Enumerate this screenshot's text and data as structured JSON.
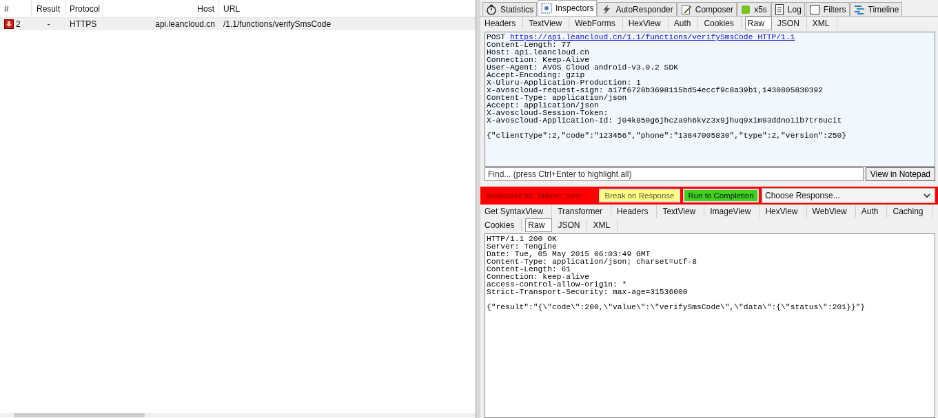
{
  "sessions": {
    "columns": [
      "#",
      "Result",
      "Protocol",
      "Host",
      "URL"
    ],
    "rows": [
      {
        "number": "2",
        "result": "-",
        "protocol": "HTTPS",
        "host": "api.leancloud.cn",
        "url": "/1.1/functions/verifySmsCode",
        "selected": false
      }
    ]
  },
  "main_tabs": [
    {
      "label": "Statistics",
      "selected": false
    },
    {
      "label": "Inspectors",
      "selected": true
    },
    {
      "label": "AutoResponder",
      "selected": false
    },
    {
      "label": "Composer",
      "selected": false
    },
    {
      "label": "x5s",
      "selected": false
    },
    {
      "label": "Log",
      "selected": false
    },
    {
      "label": "Filters",
      "selected": false
    },
    {
      "label": "Timeline",
      "selected": false
    }
  ],
  "request": {
    "tabs": [
      {
        "label": "Headers",
        "selected": false
      },
      {
        "label": "TextView",
        "selected": false
      },
      {
        "label": "WebForms",
        "selected": false
      },
      {
        "label": "HexView",
        "selected": false
      },
      {
        "label": "Auth",
        "selected": false
      },
      {
        "label": "Cookies",
        "selected": false
      },
      {
        "label": "Raw",
        "selected": true
      },
      {
        "label": "JSON",
        "selected": false
      },
      {
        "label": "XML",
        "selected": false
      }
    ],
    "method": "POST",
    "link": "https://api.leancloud.cn/1.1/functions/verifySmsCode HTTP/1.1",
    "lines": [
      "Content-Length: 77",
      "Host: api.leancloud.cn",
      "Connection: Keep-Alive",
      "User-Agent: AVOS Cloud android-v3.0.2 SDK",
      "Accept-Encoding: gzip",
      "X-Uluru-Application-Production: 1",
      "x-avoscloud-request-sign: a17f6728b3698115bd54eccf9c8a39b1,1430805830392",
      "Content-Type: application/json",
      "Accept: application/json",
      "X-avoscloud-Session-Token:",
      "X-avoscloud-Application-Id: j04k850g6jhcza9h6kvz3x9jhuq9xim93ddno1ib7tr6ucit"
    ],
    "body": "{\"clientType\":2,\"code\":\"123456\",\"phone\":\"13847005830\",\"type\":2,\"version\":250}",
    "find": {
      "placeholder": "Find... (press Ctrl+Enter to highlight all)"
    },
    "notepad_button": "View in Notepad"
  },
  "breakpoint": {
    "message": "Breakpoint hit. Tamper, then:",
    "break_button": "Break on Response",
    "run_button": "Run to Completion",
    "dropdown": "Choose Response..."
  },
  "response": {
    "tabs": [
      {
        "label": "Get SyntaxView",
        "selected": false
      },
      {
        "label": "Transformer",
        "selected": false
      },
      {
        "label": "Headers",
        "selected": false
      },
      {
        "label": "TextView",
        "selected": false
      },
      {
        "label": "ImageView",
        "selected": false
      },
      {
        "label": "HexView",
        "selected": false
      },
      {
        "label": "WebView",
        "selected": false
      },
      {
        "label": "Auth",
        "selected": false
      },
      {
        "label": "Caching",
        "selected": false
      }
    ],
    "tabs_row2": [
      {
        "label": "Cookies",
        "selected": false
      },
      {
        "label": "Raw",
        "selected": true
      },
      {
        "label": "JSON",
        "selected": false
      },
      {
        "label": "XML",
        "selected": false
      }
    ],
    "lines": [
      "HTTP/1.1 200 OK",
      "Server: Tengine",
      "Date: Tue, 05 May 2015 06:03:49 GMT",
      "Content-Type: application/json; charset=utf-8",
      "Content-Length: 61",
      "Connection: keep-alive",
      "access-control-allow-origin: *",
      "Strict-Transport-Security: max-age=31536000"
    ],
    "body": "{\"result\":\"{\\\"code\\\":200,\\\"value\\\":\\\"verifySmsCode\\\",\\\"data\\\":{\\\"status\\\":201}}\"}"
  }
}
